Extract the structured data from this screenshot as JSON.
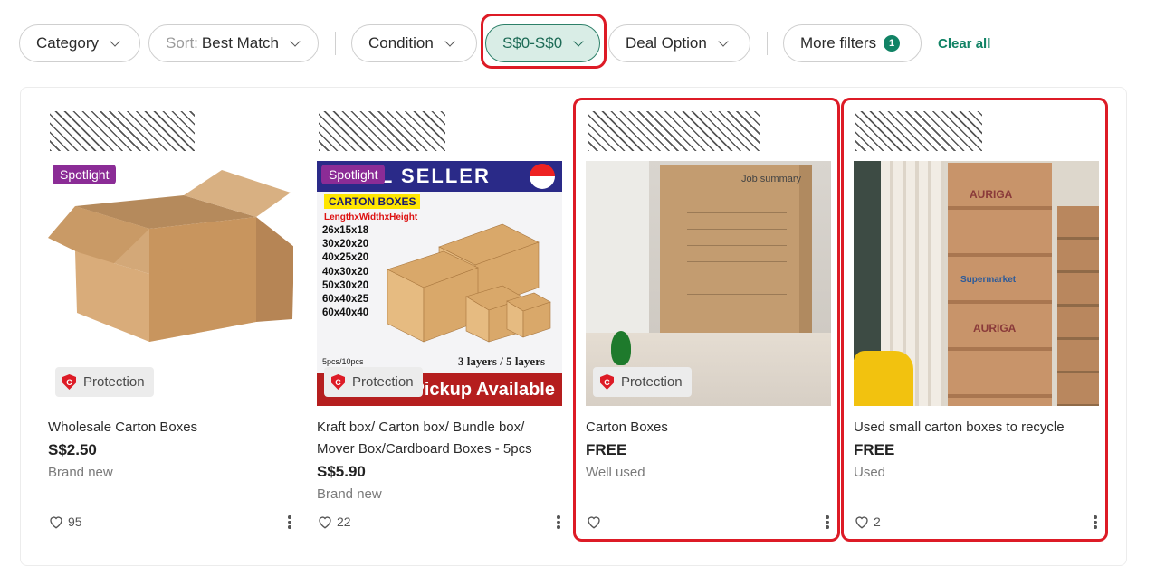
{
  "filters": {
    "category": "Category",
    "sort_prefix": "Sort:",
    "sort_value": "Best Match",
    "condition": "Condition",
    "price_range": "S$0-S$0",
    "deal_option": "Deal Option",
    "more_filters": "More filters",
    "more_filters_count": "1",
    "clear_all": "Clear all"
  },
  "accent_color": "#118365",
  "highlight_color": "#dd1b26",
  "listings": [
    {
      "spotlight": "Spotlight",
      "protection": "Protection",
      "title": "Wholesale Carton Boxes",
      "price": "S$2.50",
      "condition": "Brand new",
      "likes": "95"
    },
    {
      "spotlight": "Spotlight",
      "protection": "Protection",
      "title": "Kraft box/ Carton box/ Bundle box/ Mover Box/Cardboard Boxes - 5pcs",
      "price": "S$5.90",
      "condition": "Brand new",
      "likes": "22",
      "ad": {
        "banner": "AL SELLER",
        "heading": "CARTON BOXES",
        "dims_label": "LengthxWidthxHeight",
        "sizes": [
          "26x15x18",
          "30x20x20",
          "40x25x20",
          "40x30x20",
          "50x30x20",
          "60x40x25",
          "60x40x40"
        ],
        "pack": "5pcs/10pcs",
        "layers": "3 layers / 5 layers",
        "footer": "Pickup Available"
      }
    },
    {
      "protection": "Protection",
      "title": "Carton Boxes",
      "price": "FREE",
      "condition": "Well used",
      "likes": "",
      "box_text": "Job summary"
    },
    {
      "title": "Used small carton boxes to recycle",
      "price": "FREE",
      "condition": "Used",
      "likes": "2",
      "brand_text": "AURIGA",
      "brand_text_2": "Supermarket"
    }
  ]
}
